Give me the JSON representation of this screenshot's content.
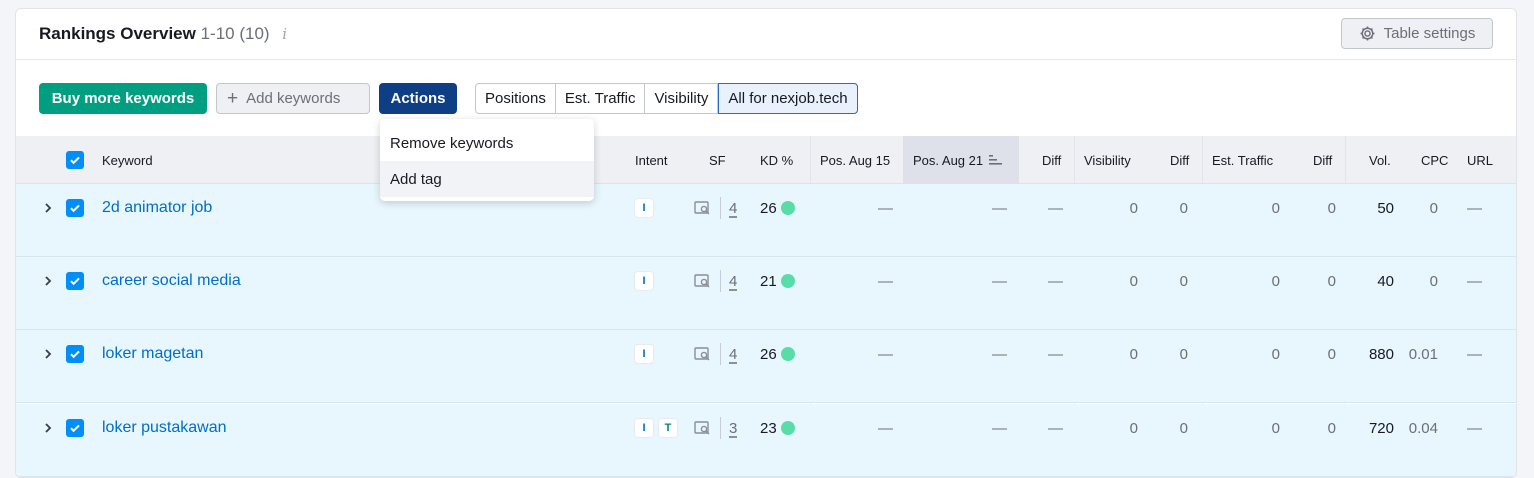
{
  "header": {
    "title": "Rankings Overview",
    "range": "1-10 (10)",
    "info_icon": "i",
    "table_settings_label": "Table settings"
  },
  "toolbar": {
    "buy_more_label": "Buy more keywords",
    "add_keywords_label": "Add keywords",
    "actions_label": "Actions",
    "segments": [
      "Positions",
      "Est. Traffic",
      "Visibility",
      "All for nexjob.tech"
    ],
    "active_segment": "All for nexjob.tech"
  },
  "actions_menu": {
    "items": [
      "Remove keywords",
      "Add tag"
    ],
    "hovered": "Add tag"
  },
  "columns": {
    "keyword": "Keyword",
    "intent": "Intent",
    "sf": "SF",
    "kd": "KD %",
    "pos1": "Pos. Aug 15",
    "pos2": "Pos. Aug 21",
    "diff1": "Diff",
    "visibility": "Visibility",
    "diff2": "Diff",
    "traffic": "Est. Traffic",
    "diff3": "Diff",
    "vol": "Vol.",
    "cpc": "CPC",
    "url": "URL"
  },
  "rows": [
    {
      "keyword": "2d animator job",
      "intent": [
        "I"
      ],
      "sf": "4",
      "kd": "26",
      "pos1": "—",
      "pos2": "—",
      "diff1": "—",
      "visibility": "0",
      "diff2": "0",
      "traffic": "0",
      "diff3": "0",
      "vol": "50",
      "cpc": "0",
      "url": "—"
    },
    {
      "keyword": "career social media",
      "intent": [
        "I"
      ],
      "sf": "4",
      "kd": "21",
      "pos1": "—",
      "pos2": "—",
      "diff1": "—",
      "visibility": "0",
      "diff2": "0",
      "traffic": "0",
      "diff3": "0",
      "vol": "40",
      "cpc": "0",
      "url": "—"
    },
    {
      "keyword": "loker magetan",
      "intent": [
        "I"
      ],
      "sf": "4",
      "kd": "26",
      "pos1": "—",
      "pos2": "—",
      "diff1": "—",
      "visibility": "0",
      "diff2": "0",
      "traffic": "0",
      "diff3": "0",
      "vol": "880",
      "cpc": "0.01",
      "url": "—"
    },
    {
      "keyword": "loker pustakawan",
      "intent": [
        "I",
        "T"
      ],
      "sf": "3",
      "kd": "23",
      "pos1": "—",
      "pos2": "—",
      "diff1": "—",
      "visibility": "0",
      "diff2": "0",
      "traffic": "0",
      "diff3": "0",
      "vol": "720",
      "cpc": "0.04",
      "url": "—"
    }
  ],
  "colors": {
    "green": "#009f81",
    "actions_blue": "#0e3f85",
    "link_blue": "#006dca",
    "checkbox_blue": "#008ff8",
    "row_selected": "#e8f6fd",
    "kd_dot": "#59dda8"
  }
}
